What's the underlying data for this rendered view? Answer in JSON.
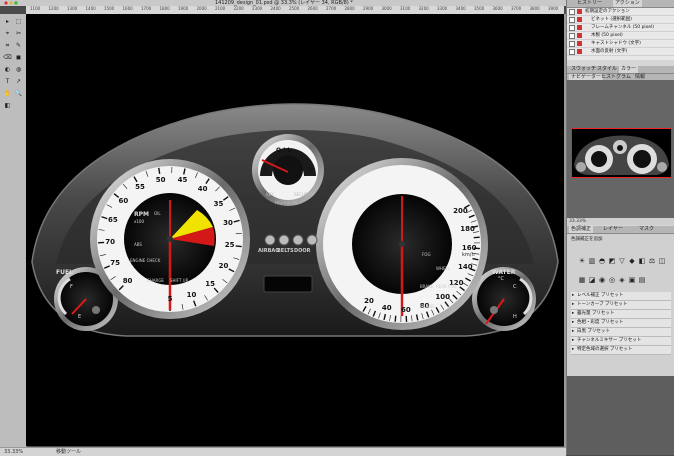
{
  "window": {
    "title": "141209_design_01.psd @ 33.3% (レイヤー 34, RGB/8) *"
  },
  "ruler_labels": [
    "1100",
    "1200",
    "1300",
    "1400",
    "1500",
    "1600",
    "1700",
    "1800",
    "1900",
    "2000",
    "2100",
    "2200",
    "2300",
    "2400",
    "2500",
    "2600",
    "2700",
    "2800",
    "2900",
    "3000",
    "3100",
    "3200",
    "3300",
    "3400",
    "3500",
    "3600",
    "3700",
    "3800",
    "3900"
  ],
  "toolbar": {
    "tools": [
      "▸",
      "⬚",
      "⌖",
      "✂",
      "⌗",
      "✎",
      "⌫",
      "◼",
      "◐",
      "◍",
      "T",
      "↗",
      "✋",
      "🔍",
      "◧"
    ]
  },
  "status": {
    "zoom": "33.33%",
    "tool": "移動ツール"
  },
  "panels": {
    "actions_tabs": [
      "ヒストリー",
      "アクション"
    ],
    "actions": [
      "初期設定のアクション",
      "ビネット (選択範囲)",
      "フレームチャンネル (50 pixel)",
      "木製 (50 pixel)",
      "キャストシャドウ (文字)",
      "水面の反射 (文字)"
    ],
    "mid_tabs": [
      "スウォッチ",
      "スタイル",
      "カラー"
    ],
    "nav_tabs": [
      "ナビゲーター",
      "ヒストグラム",
      "情報"
    ],
    "nav_zoom": "33.33%",
    "adj_tabs": [
      "色調補正",
      "レイヤー",
      "マスク"
    ],
    "adj_title": "色調補正を追加",
    "adj_icons": [
      "☀",
      "▥",
      "◓",
      "◩",
      "▽",
      "◆",
      "◧",
      "⚖",
      "◫",
      "▦",
      "◪",
      "◉",
      "◎",
      "◈",
      "▣",
      "▤"
    ],
    "presets": [
      "レベル補正 プリセット",
      "トーンカーブ プリセット",
      "露光量 プリセット",
      "色相・彩度 プリセット",
      "白黒 プリセット",
      "チャンネルミキサー プリセット",
      "特定色域の選択 プリセット"
    ]
  },
  "dashboard": {
    "tach": {
      "labels": [
        "5",
        "10",
        "15",
        "20",
        "25",
        "30",
        "35",
        "40",
        "45",
        "50",
        "55",
        "60",
        "65",
        "70",
        "75",
        "80"
      ],
      "unit": "RPM",
      "unit2": "x100",
      "indicators": [
        "OIL",
        "ABS",
        "ENGINE CHECK",
        "CHARGE",
        "SHIFT UP"
      ]
    },
    "speed": {
      "labels": [
        "20",
        "40",
        "60",
        "80",
        "100",
        "120",
        "140",
        "160",
        "180",
        "200"
      ],
      "unit": "km/h",
      "inner_labels": [
        "20",
        "40",
        "60",
        "80",
        "100",
        "120"
      ],
      "indicators": [
        "FOG",
        "WHEEL",
        "BRAKE",
        "REAR FOG",
        "CRUISE"
      ]
    },
    "oil": {
      "label": "OIL",
      "low": "L",
      "high": "H",
      "indicators": [
        "KEY",
        "SECURITY",
        "HIGHBEAM"
      ]
    },
    "center_buttons": [
      "AIRBAG",
      "BELTS",
      "DOOR"
    ],
    "fuel": {
      "label": "FUEL",
      "empty": "E",
      "full": "F"
    },
    "water": {
      "label": "WATER",
      "unit": "°C",
      "cold": "C",
      "hot": "H"
    }
  }
}
